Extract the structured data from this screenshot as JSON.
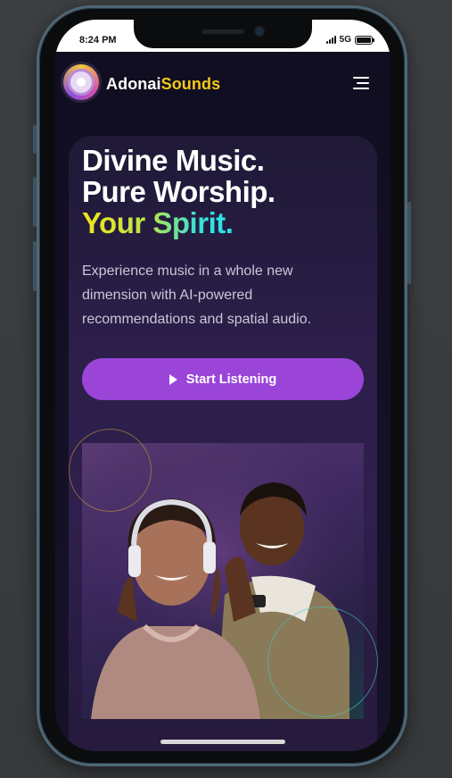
{
  "status": {
    "time": "8:24 PM",
    "network": "5G"
  },
  "brand": {
    "name_primary": "Adonai",
    "name_accent": "Sounds"
  },
  "hero": {
    "line1": "Divine Music.",
    "line2": "Pure Worship.",
    "line3": "Your Spirit.",
    "description": "Experience music in a whole new dimension with AI-powered recommendations and spatial audio.",
    "cta_label": "Start Listening"
  },
  "colors": {
    "accent_gold": "#f4c91a",
    "cta_purple": "#9a45d8",
    "background": "#100e20"
  },
  "icons": [
    "menu-icon",
    "play-icon",
    "logo-disc-icon",
    "signal-icon",
    "battery-icon"
  ]
}
